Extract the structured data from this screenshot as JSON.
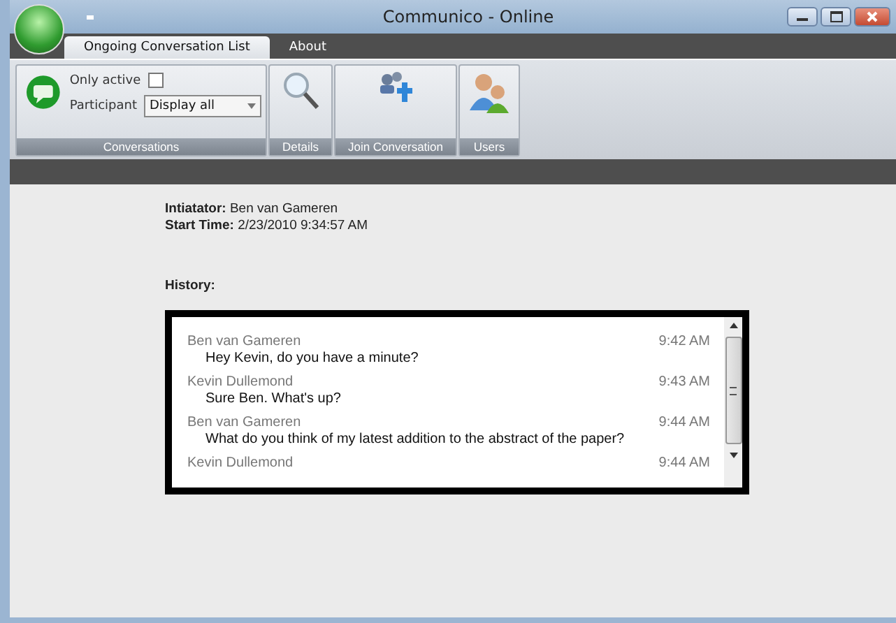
{
  "window": {
    "title": "Communico - Online"
  },
  "tabs": [
    {
      "label": "Ongoing Conversation List",
      "selected": true
    },
    {
      "label": "About",
      "selected": false
    }
  ],
  "ribbon": {
    "conversations": {
      "only_active": {
        "label": "Only active",
        "checked": false
      },
      "participant": {
        "label": "Participant",
        "value": "Display all"
      },
      "group_label": "Conversations"
    },
    "groups": [
      {
        "kind": "details",
        "label": "Details"
      },
      {
        "kind": "join",
        "label": "Join Conversation"
      },
      {
        "kind": "users",
        "label": "Users"
      }
    ]
  },
  "details": {
    "initiator": {
      "label": "Intiatator:",
      "value": "Ben van Gameren"
    },
    "start_time": {
      "label": "Start Time:",
      "value": "2/23/2010 9:34:57 AM"
    }
  },
  "history": {
    "label": "History:",
    "messages": [
      {
        "sender": "Ben van Gameren",
        "time": "9:42 AM",
        "text": "Hey Kevin, do you have a minute?"
      },
      {
        "sender": "Kevin Dullemond",
        "time": "9:43 AM",
        "text": "Sure Ben. What's up?"
      },
      {
        "sender": "Ben van Gameren",
        "time": "9:44 AM",
        "text": "What do you think of my latest addition to the abstract of the paper?"
      },
      {
        "sender": "Kevin Dullemond",
        "time": "9:44 AM"
      }
    ]
  }
}
